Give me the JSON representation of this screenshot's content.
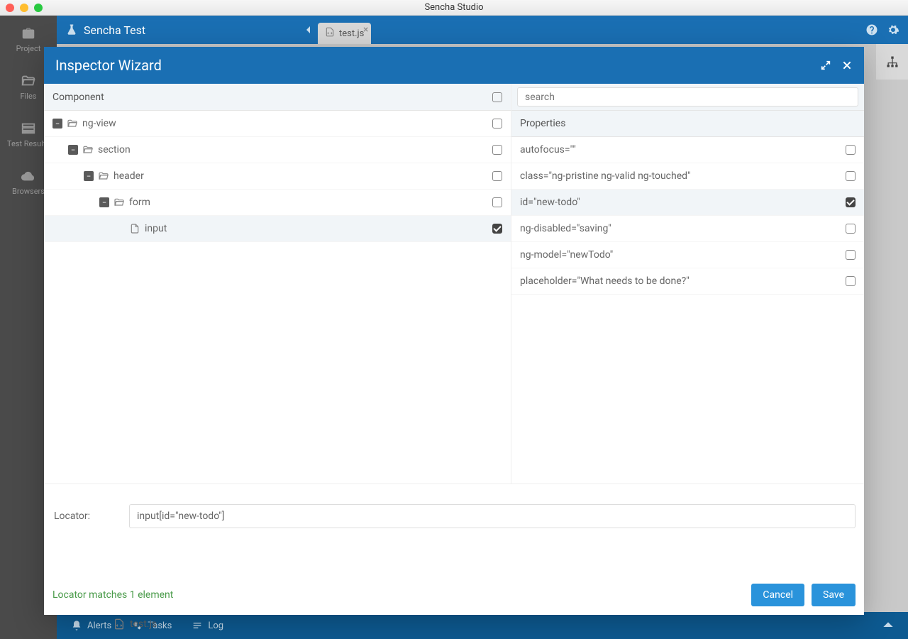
{
  "window": {
    "title": "Sencha Studio"
  },
  "appbar": {
    "app_title": "Sencha Test"
  },
  "tabs": [
    {
      "label": "test.js"
    }
  ],
  "sidebar_nav": [
    {
      "key": "project",
      "label": "Project"
    },
    {
      "key": "files",
      "label": "Files"
    },
    {
      "key": "testresults",
      "label": "Test Results"
    },
    {
      "key": "browsers",
      "label": "Browsers"
    }
  ],
  "statusbar": {
    "alerts": "Alerts",
    "tasks": "Tasks",
    "log": "Log"
  },
  "bg_file_row": "test.js",
  "modal": {
    "title": "Inspector Wizard",
    "component_header": "Component",
    "properties_header": "Properties",
    "search_placeholder": "search",
    "tree": [
      {
        "label": "ng-view",
        "depth": 0,
        "expandable": true,
        "icon": "folder",
        "checked": false
      },
      {
        "label": "section",
        "depth": 1,
        "expandable": true,
        "icon": "folder",
        "checked": false
      },
      {
        "label": "header",
        "depth": 2,
        "expandable": true,
        "icon": "folder",
        "checked": false
      },
      {
        "label": "form",
        "depth": 3,
        "expandable": true,
        "icon": "folder",
        "checked": false
      },
      {
        "label": "input",
        "depth": 4,
        "expandable": false,
        "icon": "file",
        "checked": true,
        "selected": true
      }
    ],
    "properties": [
      {
        "label": "autofocus=\"\"",
        "checked": false
      },
      {
        "label": "class=\"ng-pristine ng-valid ng-touched\"",
        "checked": false
      },
      {
        "label": "id=\"new-todo\"",
        "checked": true,
        "selected": true
      },
      {
        "label": "ng-disabled=\"saving\"",
        "checked": false
      },
      {
        "label": "ng-model=\"newTodo\"",
        "checked": false
      },
      {
        "label": "placeholder=\"What needs to be done?\"",
        "checked": false
      }
    ],
    "locator_label": "Locator:",
    "locator_value": "input[id=\"new-todo\"]",
    "locator_status": "Locator matches 1 element",
    "cancel_label": "Cancel",
    "save_label": "Save"
  }
}
